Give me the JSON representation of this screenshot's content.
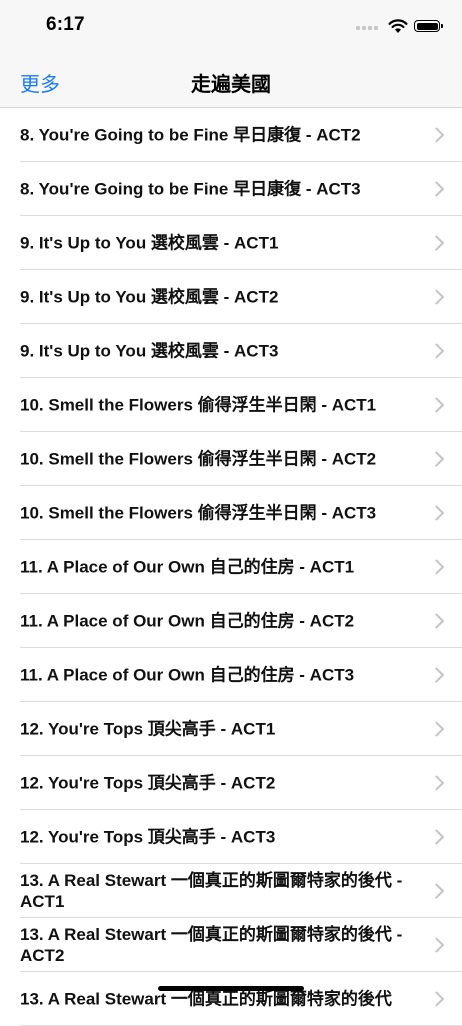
{
  "status_bar": {
    "time": "6:17"
  },
  "nav": {
    "back_label": "更多",
    "title": "走遍美國"
  },
  "list": {
    "items": [
      {
        "label": "8. You're Going to be Fine 早日康復 - ACT2"
      },
      {
        "label": "8. You're Going to be Fine 早日康復 - ACT3"
      },
      {
        "label": "9. It's Up to You 選校風雲 - ACT1"
      },
      {
        "label": "9. It's Up to You 選校風雲 - ACT2"
      },
      {
        "label": "9. It's Up to You 選校風雲 - ACT3"
      },
      {
        "label": "10. Smell the Flowers 偷得浮生半日閑 - ACT1"
      },
      {
        "label": "10. Smell the Flowers 偷得浮生半日閑 - ACT2"
      },
      {
        "label": "10. Smell the Flowers 偷得浮生半日閑 - ACT3"
      },
      {
        "label": "11. A Place of Our Own 自己的住房 - ACT1"
      },
      {
        "label": "11. A Place of Our Own 自己的住房 - ACT2"
      },
      {
        "label": "11. A Place of Our Own 自己的住房 - ACT3"
      },
      {
        "label": "12. You're Tops 頂尖高手 - ACT1"
      },
      {
        "label": "12. You're Tops 頂尖高手 - ACT2"
      },
      {
        "label": "12. You're Tops 頂尖高手 - ACT3"
      },
      {
        "label": "13. A Real Stewart 一個真正的斯圖爾特家的後代 - ACT1"
      },
      {
        "label": "13. A Real Stewart 一個真正的斯圖爾特家的後代 - ACT2"
      },
      {
        "label": "13. A Real Stewart 一個真正的斯圖爾特家的後代"
      }
    ]
  }
}
